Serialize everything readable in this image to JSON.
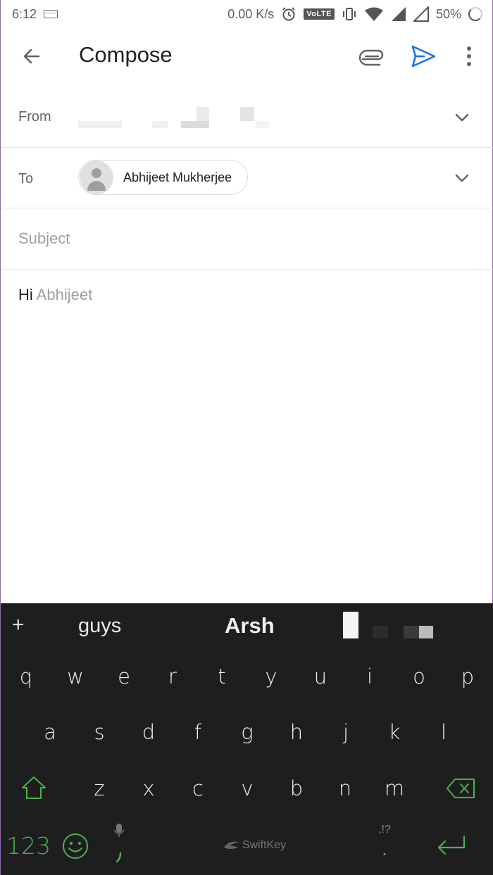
{
  "status_bar": {
    "time": "6:12",
    "net_speed": "0.00 K/s",
    "volte": "VoLTE",
    "battery": "50%"
  },
  "appbar": {
    "title": "Compose"
  },
  "from": {
    "label": "From"
  },
  "to": {
    "label": "To",
    "recipient": "Abhijeet Mukherjee"
  },
  "subject": {
    "placeholder": "Subject"
  },
  "body": {
    "typed": "Hi",
    "suggestion": " Abhijeet"
  },
  "keyboard": {
    "suggestions": [
      "guys",
      "Arsh"
    ],
    "plus": "+",
    "row1": [
      "q",
      "w",
      "e",
      "r",
      "t",
      "y",
      "u",
      "i",
      "o",
      "p"
    ],
    "row2": [
      "a",
      "s",
      "d",
      "f",
      "g",
      "h",
      "j",
      "k",
      "l"
    ],
    "row3": [
      "z",
      "x",
      "c",
      "v",
      "b",
      "n",
      "m"
    ],
    "num_label": "123",
    "space_label": "SwiftKey",
    "period_hint": ",!?",
    "period": "."
  },
  "colors": {
    "send_blue": "#1a73e8",
    "keyboard_bg": "#1e1e1e",
    "keyboard_accent": "#4caf50"
  }
}
